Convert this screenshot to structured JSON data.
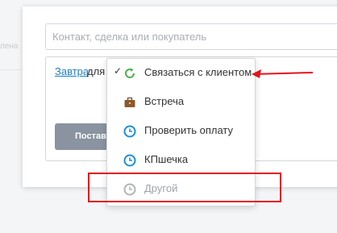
{
  "background": {
    "left_text": "лена"
  },
  "search": {
    "placeholder": "Контакт, сделка или покупатель"
  },
  "task": {
    "date_link": "Завтра",
    "for_text": "для",
    "post_button": "Постав"
  },
  "dropdown": {
    "items": [
      {
        "label": "Связаться с клиентом",
        "icon": "refresh-icon",
        "checked": true,
        "color": "#4caf50"
      },
      {
        "label": "Встреча",
        "icon": "briefcase-icon",
        "checked": false,
        "color": "#8b5a2b"
      },
      {
        "label": "Проверить оплату",
        "icon": "clock-icon",
        "checked": false,
        "color": "#1a8fd6"
      },
      {
        "label": "КПшечка",
        "icon": "clock-icon",
        "checked": false,
        "color": "#1a8fd6"
      },
      {
        "label": "Другой",
        "icon": "clock-icon",
        "checked": false,
        "color": "#b0b4b8"
      }
    ]
  },
  "colors": {
    "accent": "#1a7fc1",
    "annotation_red": "#e4141b"
  }
}
